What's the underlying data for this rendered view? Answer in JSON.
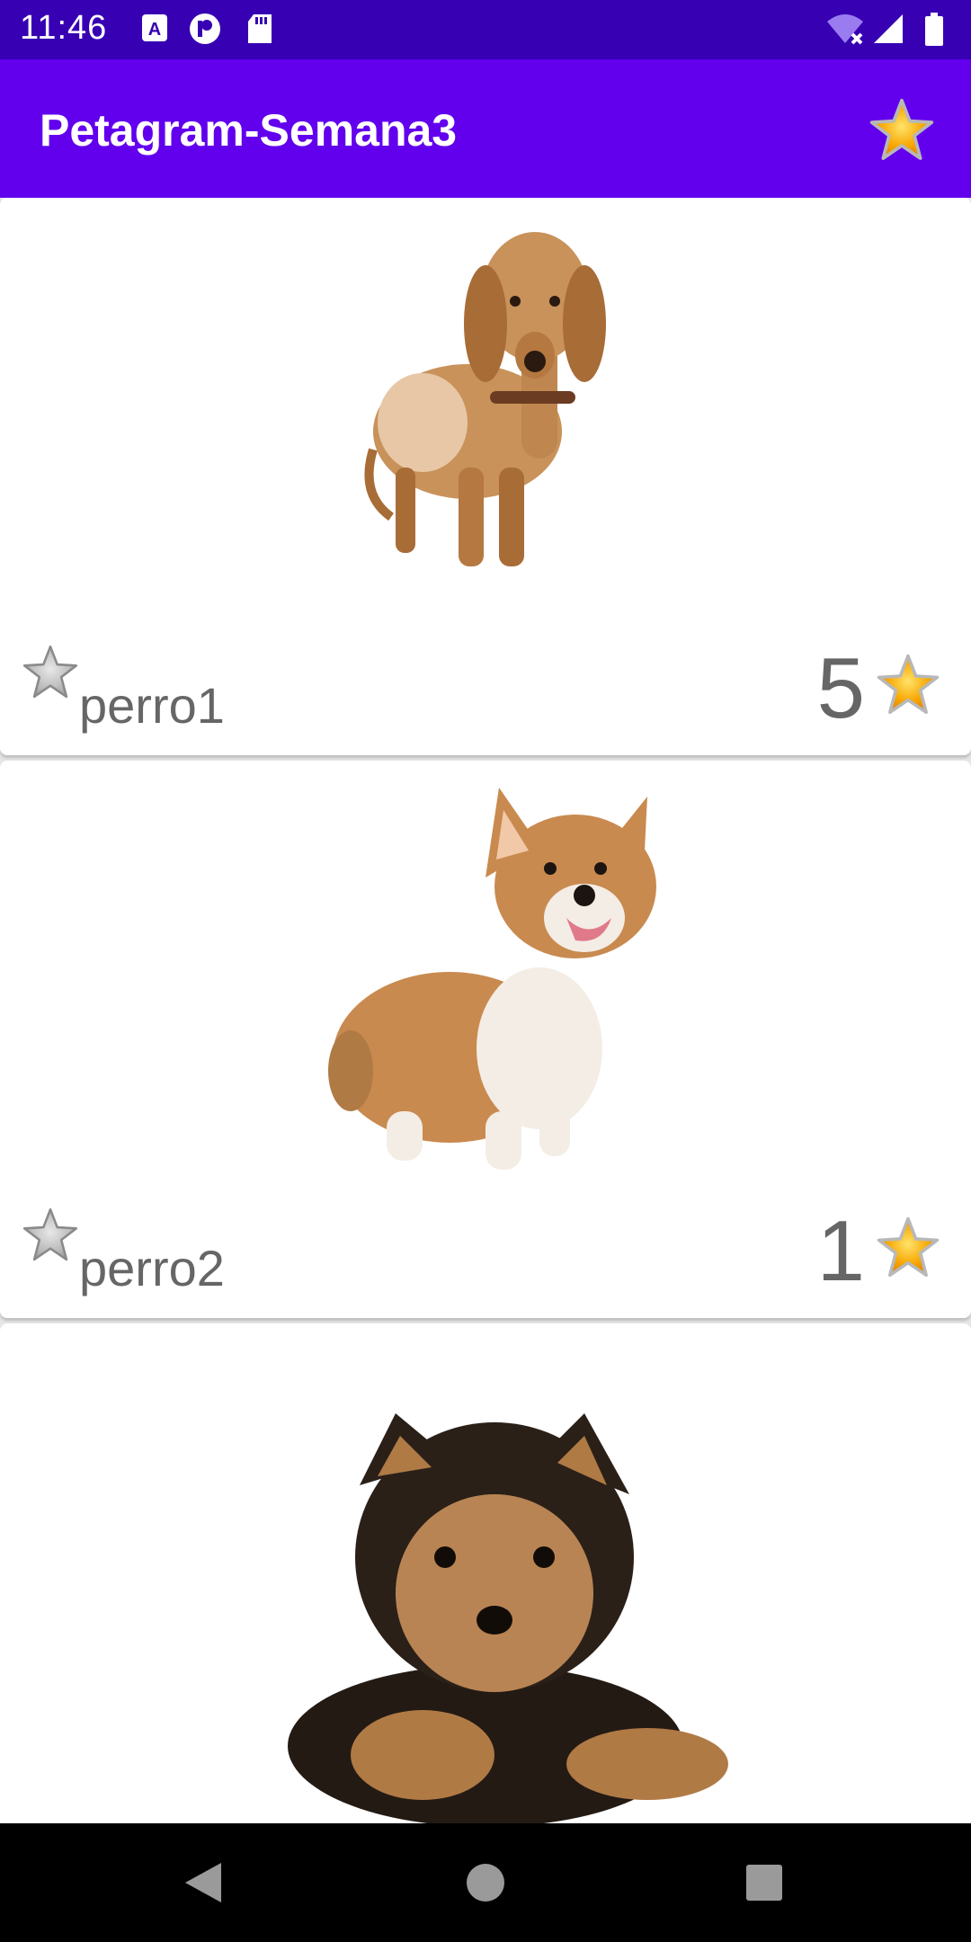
{
  "status_bar": {
    "time": "11:46",
    "left_icons": [
      "accessibility-a-icon",
      "sync-circle-icon",
      "sd-card-icon"
    ],
    "right_icons": [
      "wifi-no-internet-icon",
      "signal-icon",
      "battery-icon"
    ]
  },
  "app_bar": {
    "title": "Petagram-Semana3",
    "action_icon": "favorite-star-icon"
  },
  "pets": [
    {
      "name": "perro1",
      "likes": "5",
      "image": "dachshund-photo"
    },
    {
      "name": "perro2",
      "likes": "1",
      "image": "corgi-photo"
    },
    {
      "name": "",
      "likes": "",
      "image": "yorkshire-puppy-photo"
    }
  ],
  "nav_bar": {
    "items": [
      "back-icon",
      "home-icon",
      "recents-icon"
    ]
  },
  "colors": {
    "status_bar": "#3700b3",
    "app_bar": "#6200ee",
    "star_gold": "#f7a600",
    "star_gray": "#b0b0b0"
  }
}
